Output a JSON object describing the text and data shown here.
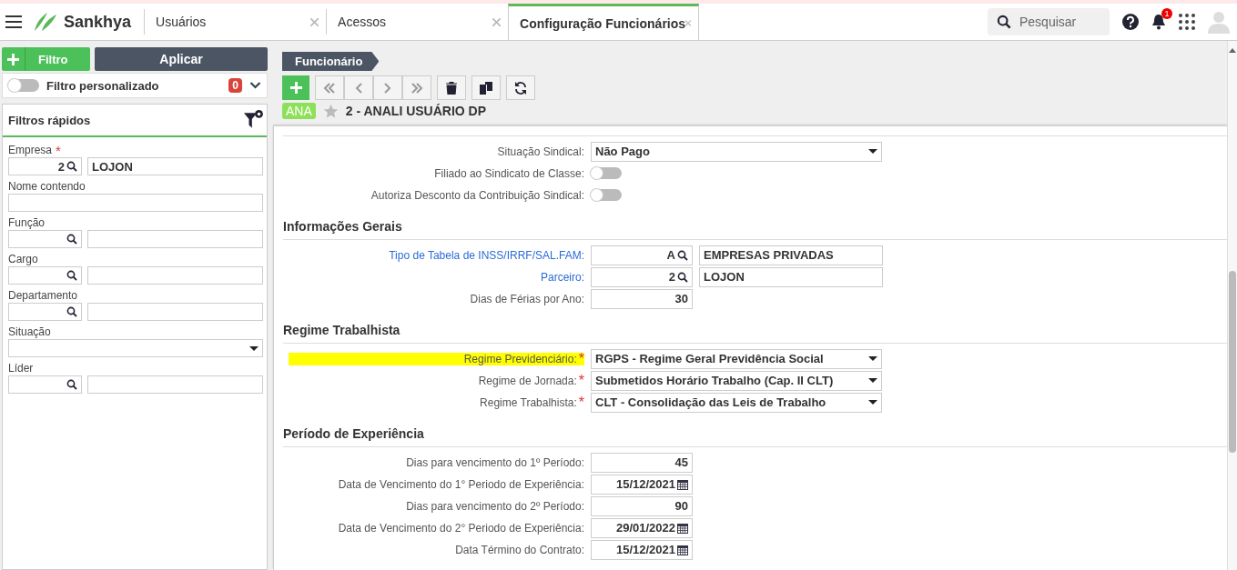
{
  "header": {
    "logo": "Sankhya",
    "tabs": [
      {
        "label": "Usuários",
        "selected": false
      },
      {
        "label": "Acessos",
        "selected": false
      },
      {
        "label": "Configuração Funcionários",
        "selected": true
      }
    ],
    "search": {
      "placeholder": "Pesquisar"
    },
    "notification_count": "1"
  },
  "filter_panel": {
    "add_filter": "Filtro",
    "apply": "Aplicar",
    "custom_filter": {
      "label": "Filtro personalizado",
      "on": false,
      "count": "0"
    },
    "quick_filters_title": "Filtros rápidos",
    "fields": [
      {
        "label": "Empresa",
        "required_mark": "*",
        "kind": "lookup",
        "code": "2",
        "description": "LOJON"
      },
      {
        "label": "Nome contendo",
        "kind": "text"
      },
      {
        "label": "Função",
        "kind": "lookup"
      },
      {
        "label": "Cargo",
        "kind": "lookup"
      },
      {
        "label": "Departamento",
        "kind": "lookup"
      },
      {
        "label": "Situação",
        "kind": "select"
      },
      {
        "label": "Líder",
        "kind": "lookup"
      }
    ]
  },
  "record": {
    "breadcrumb": "Funcionário",
    "badge": "ANA",
    "favorite": false,
    "title": "2 - ANALI USUÁRIO DP"
  },
  "sections": [
    {
      "fields": [
        {
          "label": "Situação Sindical:",
          "kind": "select",
          "value": "Não Pago"
        },
        {
          "label": "Filiado ao Sindicato de Classe:",
          "kind": "toggle",
          "on": false
        },
        {
          "label": "Autoriza Desconto da Contribuição Sindical:",
          "kind": "toggle",
          "on": false
        }
      ]
    },
    {
      "title": "Informações Gerais",
      "fields": [
        {
          "label": "Tipo de Tabela de INSS/IRRF/SAL.FAM:",
          "link": true,
          "kind": "lookup",
          "code": "A",
          "description": "EMPRESAS PRIVADAS"
        },
        {
          "label": "Parceiro:",
          "link": true,
          "kind": "lookup",
          "code": "2",
          "description": "LOJON"
        },
        {
          "label": "Dias de Férias por Ano:",
          "kind": "number",
          "value": "30"
        }
      ]
    },
    {
      "title": "Regime Trabalhista",
      "fields": [
        {
          "label": "Regime Previdenciário:",
          "required_mark": "*",
          "highlighted": true,
          "kind": "select",
          "value": "RGPS - Regime Geral Previdência Social"
        },
        {
          "label": "Regime de Jornada:",
          "required_mark": "*",
          "kind": "select",
          "value": "Submetidos Horário Trabalho (Cap. II CLT)"
        },
        {
          "label": "Regime Trabalhista:",
          "required_mark": "*",
          "kind": "select",
          "value": "CLT - Consolidação das Leis de Trabalho"
        }
      ]
    },
    {
      "title": "Período de Experiência",
      "fields": [
        {
          "label": "Dias para vencimento do 1º Período:",
          "kind": "number",
          "value": "45"
        },
        {
          "label": "Data de Vencimento do 1° Periodo de Experiência:",
          "kind": "date",
          "value": "15/12/2021"
        },
        {
          "label": "Dias para vencimento do 2º Período:",
          "kind": "number",
          "value": "90"
        },
        {
          "label": "Data de Vencimento do 2° Periodo de Experiência:",
          "kind": "date",
          "value": "29/01/2022"
        },
        {
          "label": "Data Término do Contrato:",
          "kind": "date",
          "value": "15/12/2021"
        }
      ]
    }
  ]
}
